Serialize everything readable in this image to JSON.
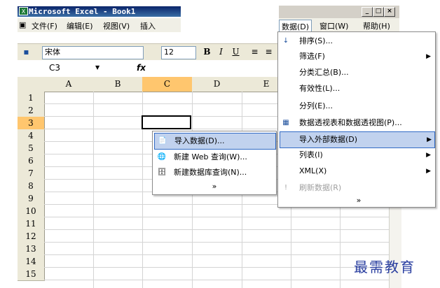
{
  "window": {
    "title": "Microsoft Excel - Book1",
    "app_icon": "excel-icon"
  },
  "menubar": {
    "file": "文件(F)",
    "edit": "编辑(E)",
    "view": "视图(V)",
    "insert": "插入",
    "data": "数据(D)",
    "window": "窗口(W)",
    "help": "帮助(H)"
  },
  "toolbar": {
    "font_name": "宋体",
    "font_size": "12",
    "bold": "B",
    "italic": "I",
    "underline": "U"
  },
  "formula_bar": {
    "cell_ref": "C3",
    "fx": "fx"
  },
  "columns": [
    "A",
    "B",
    "C",
    "D",
    "E"
  ],
  "rows": [
    "1",
    "2",
    "3",
    "4",
    "5",
    "6",
    "7",
    "8",
    "9",
    "10",
    "11",
    "12",
    "13",
    "14",
    "15"
  ],
  "data_menu": {
    "sort": "排序(S)...",
    "filter": "筛选(F)",
    "subtotal": "分类汇总(B)...",
    "validation": "有效性(L)...",
    "text_to_columns": "分列(E)...",
    "pivot": "数据透视表和数据透视图(P)...",
    "import_external": "导入外部数据(D)",
    "list": "列表(I)",
    "xml": "XML(X)",
    "refresh": "刷新数据(R)",
    "expand": "»"
  },
  "submenu": {
    "import_data": "导入数据(D)...",
    "new_web_query": "新建 Web 查询(W)...",
    "new_db_query": "新建数据库查询(N)...",
    "expand": "»"
  },
  "watermark": "最需教育",
  "colors": {
    "title_start": "#0a246a",
    "title_end": "#3a6ea5",
    "menu_highlight": "#c1d2ee",
    "selected_header": "#ffc66e"
  }
}
